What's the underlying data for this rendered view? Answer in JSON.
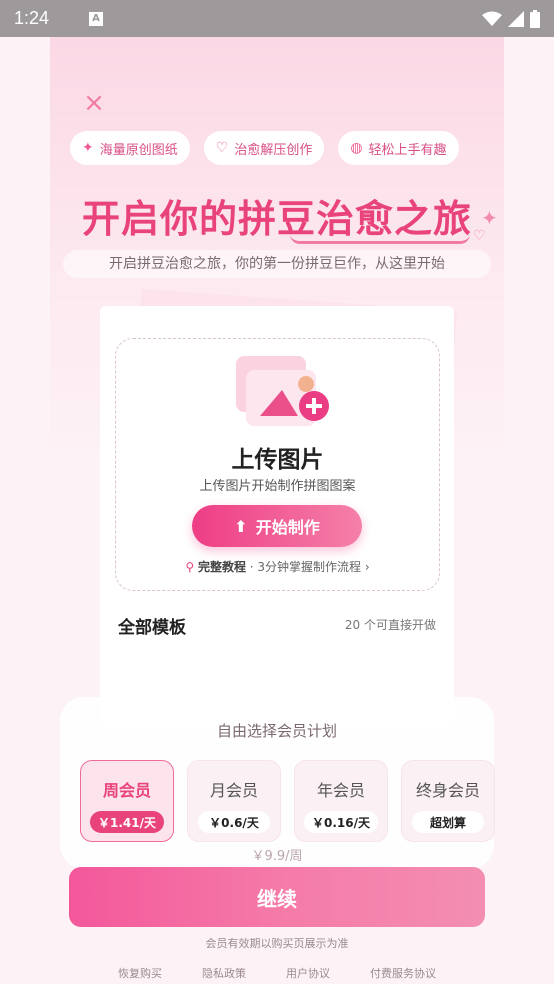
{
  "status_bar": {
    "time": "1:24"
  },
  "features": [
    {
      "icon": "sparkle-icon",
      "label": "海量原创图纸"
    },
    {
      "icon": "heart-icon",
      "label": "治愈解压创作"
    },
    {
      "icon": "palette-icon",
      "label": "轻松上手有趣"
    }
  ],
  "headline": "开启你的拼豆治愈之旅",
  "subtitle": "开启拼豆治愈之旅，你的第一份拼豆巨作，从这里开始",
  "upload": {
    "title": "上传图片",
    "desc": "上传图片开始制作拼图图案",
    "button": "开始制作",
    "tutorial_bold": "完整教程",
    "tutorial_rest": "· 3分钟掌握制作流程"
  },
  "templates": {
    "title": "全部模板",
    "count": "20 个可直接开做"
  },
  "membership": {
    "title": "自由选择会员计划",
    "plans": [
      {
        "name": "周会员",
        "price": "￥1.41/天",
        "active": true
      },
      {
        "name": "月会员",
        "price": "￥0.6/天",
        "active": false
      },
      {
        "name": "年会员",
        "price": "￥0.16/天",
        "active": false
      },
      {
        "name": "终身会员",
        "price": "超划算",
        "active": false
      }
    ],
    "note": "￥9.9/周",
    "continue": "继续",
    "validity": "会员有效期以购买页展示为准"
  },
  "footer": [
    "恢复购买",
    "隐私政策",
    "用户协议",
    "付费服务协议"
  ],
  "colors": {
    "accent": "#e9437b",
    "button": "#f3579a"
  }
}
